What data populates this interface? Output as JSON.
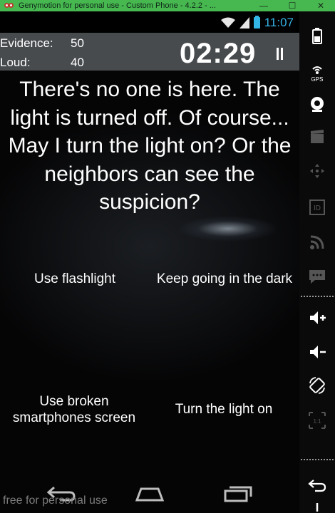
{
  "window": {
    "title": "Genymotion for personal use - Custom Phone - 4.2.2 - ...",
    "minimize_glyph": "—",
    "maximize_glyph": "☐",
    "close_glyph": "✕"
  },
  "status_bar": {
    "time": "11:07",
    "icons": [
      "wifi-icon",
      "signal-icon",
      "battery-icon"
    ]
  },
  "hud": {
    "evidence_label": "Evidence:",
    "evidence_value": "50",
    "loud_label": "Loud:",
    "loud_value": "40",
    "timer": "02:29"
  },
  "story_text": "There's no one is here. The light is turned off. Of course... May I turn the light on? Or the neighbors can see the suspicion?",
  "choices": [
    {
      "label": "Use flashlight"
    },
    {
      "label": "Keep going in the dark"
    },
    {
      "label": "Use broken smartphones screen"
    },
    {
      "label": "Turn the light on"
    }
  ],
  "nav_bar": {
    "icons": [
      "back-icon",
      "home-icon",
      "recent-apps-icon"
    ]
  },
  "watermark": "free for personal use",
  "sidebar": {
    "gps_label": "GPS",
    "id_label": "ID",
    "scale_label": "1:1",
    "tools": [
      "battery-icon",
      "gps-icon",
      "camera-icon",
      "media-icon",
      "dpad-icon",
      "id-icon",
      "rss-icon",
      "sms-icon",
      "volume-up-icon",
      "volume-down-icon",
      "rotate-icon",
      "scale-icon",
      "back-icon",
      "power-icon"
    ]
  },
  "colors": {
    "title_bar": "#46b84f",
    "accent_blue": "#33b5e5",
    "hud_bg": "#55585c"
  }
}
